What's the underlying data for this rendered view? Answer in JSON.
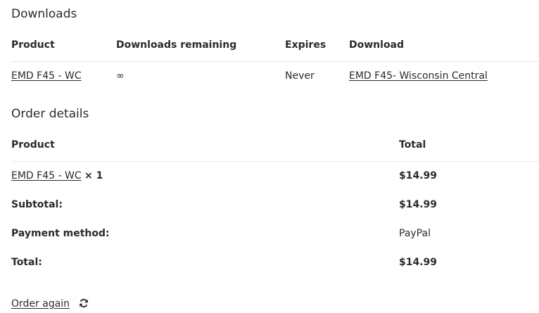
{
  "downloads": {
    "title": "Downloads",
    "headers": {
      "product": "Product",
      "remaining": "Downloads remaining",
      "expires": "Expires",
      "download": "Download"
    },
    "row": {
      "product": "EMD F45 - WC",
      "remaining": "∞",
      "expires": "Never",
      "download": "EMD F45- Wisconsin Central"
    }
  },
  "order_details": {
    "title": "Order details",
    "headers": {
      "product": "Product",
      "total": "Total"
    },
    "item": {
      "product": "EMD F45 - WC",
      "quantity": "× 1",
      "total": "$14.99"
    },
    "subtotal": {
      "label": "Subtotal:",
      "value": "$14.99"
    },
    "payment_method": {
      "label": "Payment method:",
      "value": "PayPal"
    },
    "total": {
      "label": "Total:",
      "value": "$14.99"
    }
  },
  "actions": {
    "order_again": "Order again",
    "order_again_icon": "refresh-icon"
  }
}
